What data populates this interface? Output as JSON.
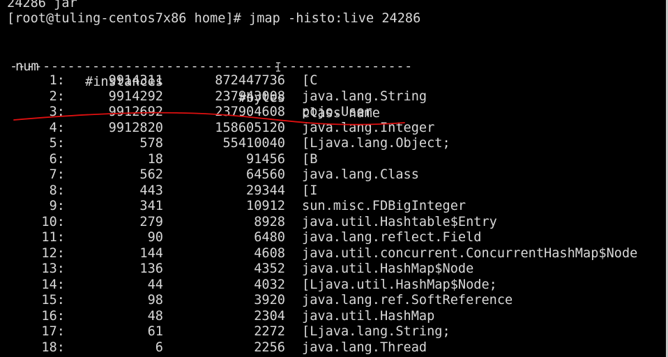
{
  "terminal": {
    "prev_line": "24286 jar",
    "prompt": "[root@tuling-centos7x86 home]# jmap -histo:live 24286",
    "headers": {
      "num": "num",
      "instances": "#instances",
      "bytes": "#bytes",
      "class_name": "class name"
    },
    "separator": "-------------------------------------------------",
    "rows": [
      {
        "num": "1:",
        "instances": "9914311",
        "bytes": "872447736",
        "class": "[C"
      },
      {
        "num": "2:",
        "instances": "9914292",
        "bytes": "237943008",
        "class": "java.lang.String"
      },
      {
        "num": "3:",
        "instances": "9912692",
        "bytes": "237904608",
        "class": "pojo.User"
      },
      {
        "num": "4:",
        "instances": "9912820",
        "bytes": "158605120",
        "class": "java.lang.Integer"
      },
      {
        "num": "5:",
        "instances": "578",
        "bytes": "55410040",
        "class": "[Ljava.lang.Object;"
      },
      {
        "num": "6:",
        "instances": "18",
        "bytes": "91456",
        "class": "[B"
      },
      {
        "num": "7:",
        "instances": "562",
        "bytes": "64560",
        "class": "java.lang.Class"
      },
      {
        "num": "8:",
        "instances": "443",
        "bytes": "29344",
        "class": "[I"
      },
      {
        "num": "9:",
        "instances": "341",
        "bytes": "10912",
        "class": "sun.misc.FDBigInteger"
      },
      {
        "num": "10:",
        "instances": "279",
        "bytes": "8928",
        "class": "java.util.Hashtable$Entry"
      },
      {
        "num": "11:",
        "instances": "90",
        "bytes": "6480",
        "class": "java.lang.reflect.Field"
      },
      {
        "num": "12:",
        "instances": "144",
        "bytes": "4608",
        "class": "java.util.concurrent.ConcurrentHashMap$Node"
      },
      {
        "num": "13:",
        "instances": "136",
        "bytes": "4352",
        "class": "java.util.HashMap$Node"
      },
      {
        "num": "14:",
        "instances": "44",
        "bytes": "4032",
        "class": "[Ljava.util.HashMap$Node;"
      },
      {
        "num": "15:",
        "instances": "98",
        "bytes": "3920",
        "class": "java.lang.ref.SoftReference"
      },
      {
        "num": "16:",
        "instances": "48",
        "bytes": "2304",
        "class": "java.util.HashMap"
      },
      {
        "num": "17:",
        "instances": "61",
        "bytes": "2272",
        "class": "[Ljava.lang.String;"
      },
      {
        "num": "18:",
        "instances": "6",
        "bytes": "2256",
        "class": "java.lang.Thread"
      }
    ]
  },
  "colors": {
    "background": "#000000",
    "text": "#d8d8d8",
    "annotation": "#e01010"
  },
  "icons": {
    "cursor": "ibeam-cursor-icon"
  }
}
